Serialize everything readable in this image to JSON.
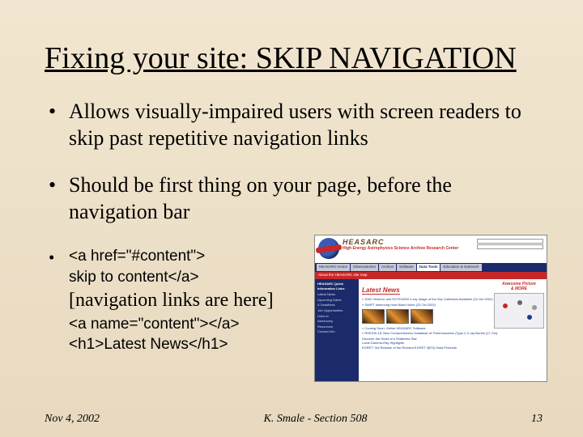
{
  "title": "Fixing your site: SKIP NAVIGATION",
  "bullets": [
    "Allows visually-impaired users with screen readers to skip past repetitive navigation links",
    "Should be first thing on your page, before the navigation bar"
  ],
  "code": {
    "line1": "<a href=\"#content\">",
    "line2": "skip to content</a>",
    "nav": "[navigation links are here]",
    "line3": "<a name=\"content\"></a>",
    "line4": "<h1>Latest News</h1>"
  },
  "footer": {
    "date": "Nov 4, 2002",
    "author": "K. Smale - Section 508",
    "page": "13"
  },
  "screenshot": {
    "brand": "HEASARC",
    "brand_sub": "High Energy Astrophysics Science Archive Research Center",
    "tabs": [
      "HEASARC Home",
      "Observatories",
      "Archive",
      "Software",
      "Data Tools",
      "Education & Outreach"
    ],
    "strip": "About the HEASARC  site map",
    "side_hdr": "HEASARC Quick Information Links",
    "side": [
      "Latest News",
      "Upcoming Dates",
      "& Deadlines",
      "Job Opportunities",
      "Links to",
      "Astronomy",
      "Resources",
      "Contact Info"
    ],
    "news_hdr": "Latest News",
    "items": [
      "» 2002 Observe and RXTE/ASM X-ray Image of the Sky Calendars Available (24 Oct 2002)",
      "» SWIFT observing near Black Holes (23 Oct 2002)",
      "» Coming Soon: Online HEASARC Software",
      "» RHESSI-16: New Comprehensive Database of Thermonuclear (Type I) X-ray Bursts (17 Oct)",
      "Local Gamma-Ray Highlights"
    ],
    "lines": [
      "Discover the Heart of a Shattered Star",
      "EGRET: 3rd Release of the Revised EGRET 3(EG) Data Products"
    ],
    "pic_title": "Awesome Picture",
    "pic_sub": "& MORE"
  }
}
